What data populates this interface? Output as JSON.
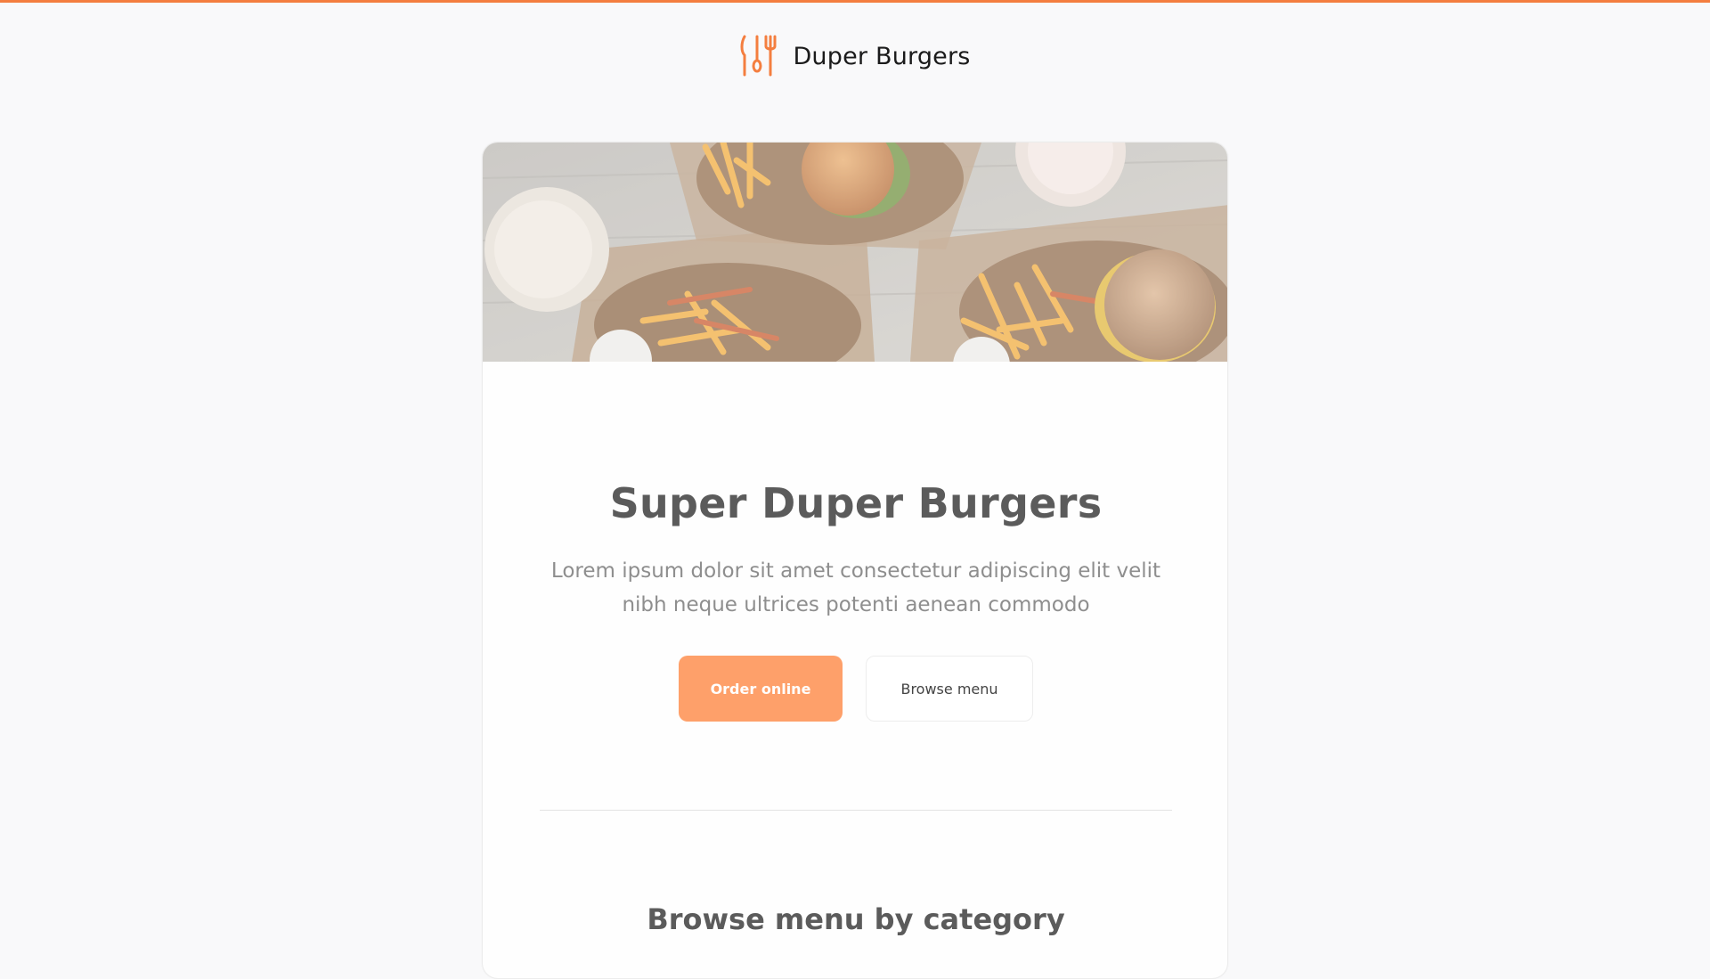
{
  "theme": {
    "accent": "#f47e3f",
    "primary_button": "#fea06a",
    "heading": "#5b5b5b",
    "body_text": "#8e8e8e"
  },
  "header": {
    "brand_name": "Duper Burgers",
    "logo_icon": "fork-knife-icon"
  },
  "hero": {
    "image_alt": "burgers, fries and milkshakes",
    "title": "Super Duper Burgers",
    "description": "Lorem ipsum dolor sit amet consectetur adipiscing elit velit nibh neque ultrices potenti aenean commodo",
    "primary_cta": "Order online",
    "secondary_cta": "Browse menu"
  },
  "menu_section": {
    "title": "Browse menu by category"
  }
}
